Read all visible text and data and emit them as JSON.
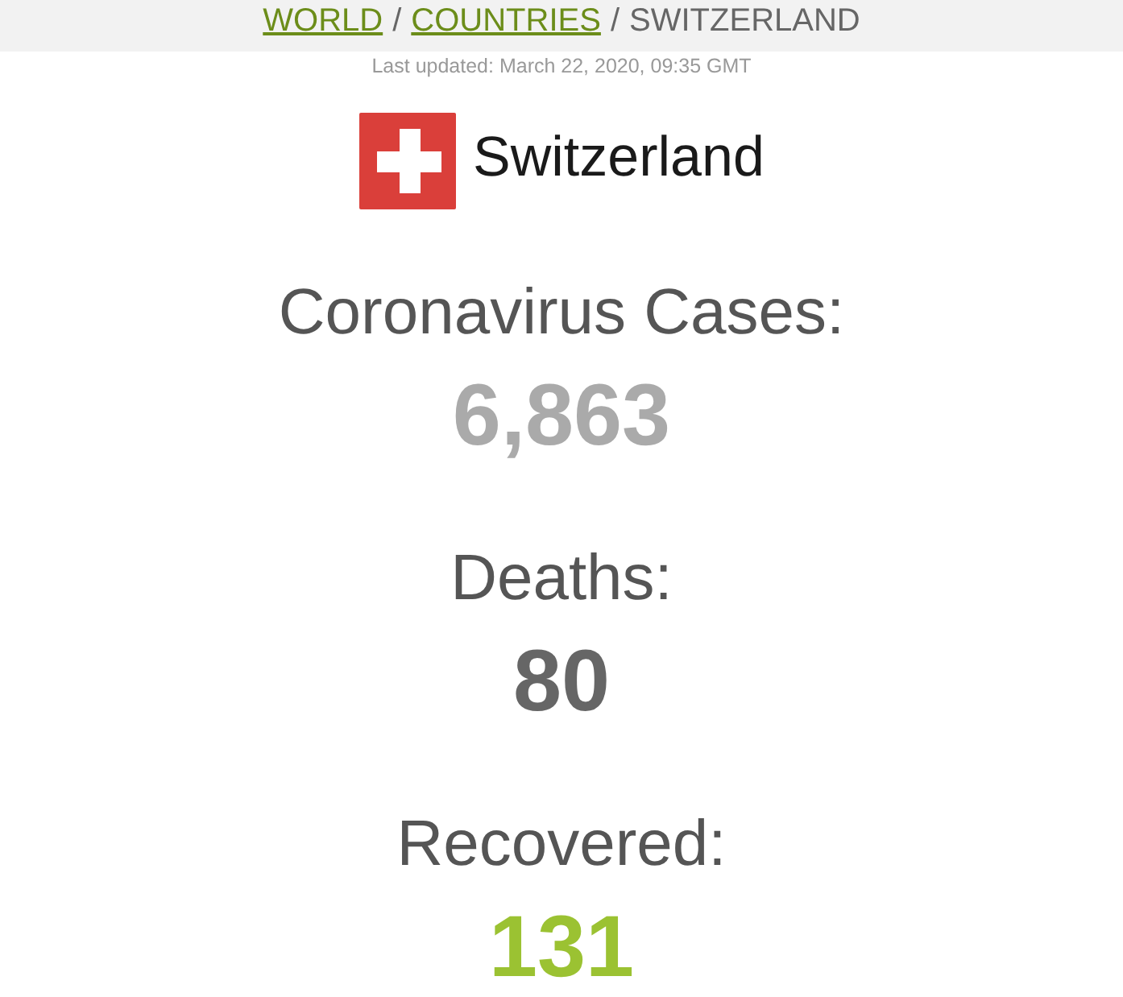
{
  "breadcrumb": {
    "separator": "/",
    "items": [
      {
        "label": "WORLD",
        "kind": "link"
      },
      {
        "label": "COUNTRIES",
        "kind": "link"
      },
      {
        "label": "SWITZERLAND",
        "kind": "current"
      }
    ]
  },
  "last_updated": "Last updated: March 22, 2020, 09:35 GMT",
  "country": {
    "name": "Switzerland"
  },
  "stats": [
    {
      "label": "Coronavirus Cases:",
      "value": "6,863",
      "color": "#aaaaaa"
    },
    {
      "label": "Deaths:",
      "value": "80",
      "color": "#666666"
    },
    {
      "label": "Recovered:",
      "value": "131",
      "color": "#9bc232"
    }
  ]
}
